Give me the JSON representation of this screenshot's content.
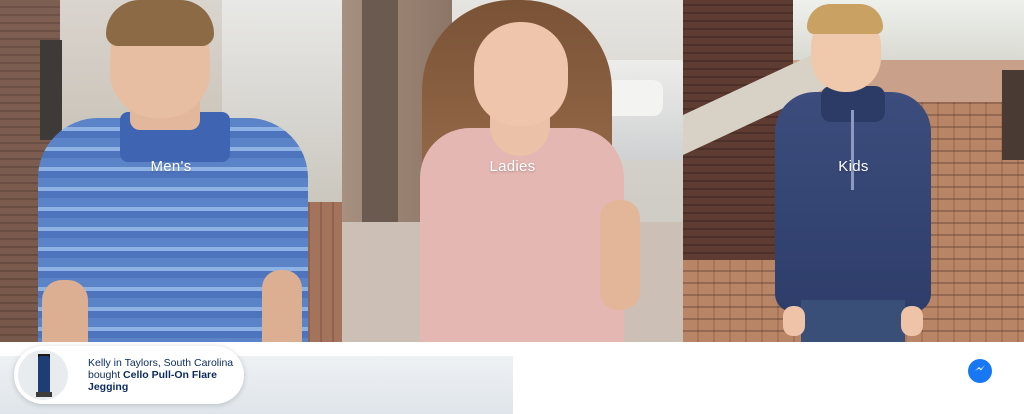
{
  "tiles": [
    {
      "label": "Men's"
    },
    {
      "label": "Ladies"
    },
    {
      "label": "Kids"
    }
  ],
  "purchase_popup": {
    "line1": "Kelly in Taylors, South Carolina",
    "prefix": "bought ",
    "product": "Cello Pull-On Flare Jegging"
  },
  "icons": {
    "messenger": "messenger-icon"
  },
  "colors": {
    "messenger_blue": "#1877f2",
    "popup_text": "#0b2a5b"
  }
}
